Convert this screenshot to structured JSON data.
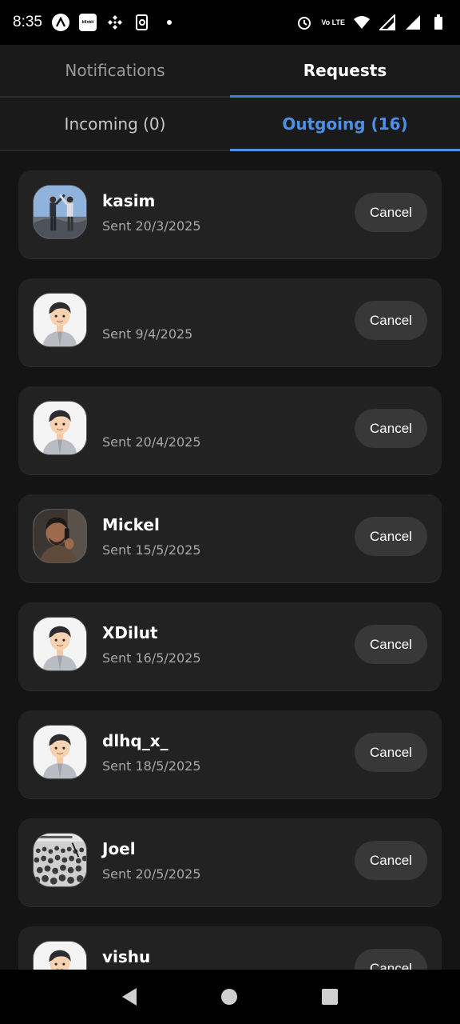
{
  "status_bar": {
    "time": "8:35",
    "app_icons": [
      "app-a-icon",
      "blinkit-icon",
      "binance-icon",
      "phonepe-icon",
      "dot-icon"
    ],
    "blinkit_text": "blinkit",
    "system_icons": [
      "alarm-icon",
      "volte-icon",
      "wifi-icon",
      "signal-icon",
      "signal-icon",
      "battery-icon"
    ],
    "volte_text": "Vo LTE"
  },
  "top_tabs": [
    {
      "label": "Notifications",
      "active": false
    },
    {
      "label": "Requests",
      "active": true
    }
  ],
  "sub_tabs": [
    {
      "label": "Incoming (0)",
      "active": false
    },
    {
      "label": "Outgoing (16)",
      "active": true
    }
  ],
  "accent_color": "#4e8fe8",
  "requests": [
    {
      "name": "kasim",
      "sent": "Sent 20/3/2025",
      "avatar": "photo-two-people",
      "action": "Cancel"
    },
    {
      "name": "",
      "sent": "Sent 9/4/2025",
      "avatar": "default-cartoon",
      "action": "Cancel"
    },
    {
      "name": "",
      "sent": "Sent 20/4/2025",
      "avatar": "default-cartoon",
      "action": "Cancel"
    },
    {
      "name": "Mickel",
      "sent": "Sent 15/5/2025",
      "avatar": "photo-man-phone",
      "action": "Cancel"
    },
    {
      "name": "XDilut",
      "sent": "Sent 16/5/2025",
      "avatar": "default-cartoon",
      "action": "Cancel"
    },
    {
      "name": "dlhq_x_",
      "sent": "Sent 18/5/2025",
      "avatar": "default-cartoon",
      "action": "Cancel"
    },
    {
      "name": "Joel",
      "sent": "Sent 20/5/2025",
      "avatar": "photo-crowd",
      "action": "Cancel"
    },
    {
      "name": "vishu",
      "sent": "",
      "avatar": "default-cartoon",
      "action": "Cancel"
    }
  ],
  "nav_bar": [
    "back-icon",
    "home-icon",
    "recents-icon"
  ]
}
